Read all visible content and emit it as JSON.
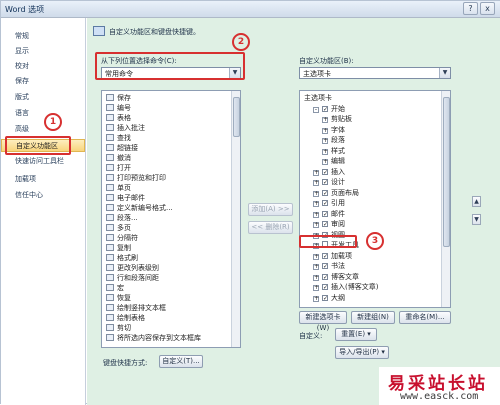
{
  "window": {
    "title": "Word 选项",
    "help_button": "?",
    "close_button": "x"
  },
  "sidebar": {
    "items": [
      {
        "label": "常规"
      },
      {
        "label": "显示"
      },
      {
        "label": "校对"
      },
      {
        "label": "保存"
      },
      {
        "label": "版式"
      },
      {
        "label": "语言"
      },
      {
        "label": "高级"
      },
      {
        "label": "自定义功能区"
      },
      {
        "label": "快速访问工具栏"
      },
      {
        "label": "加载项"
      },
      {
        "label": "信任中心"
      }
    ]
  },
  "header": {
    "description": "自定义功能区和键盘快捷键。"
  },
  "left_panel": {
    "label": "从下列位置选择命令(C):",
    "combo_value": "常用命令",
    "commands": [
      "保存",
      "编号",
      "表格",
      "插入批注",
      "查找",
      "超链接",
      "撤消",
      "打开",
      "打印预览和打印",
      "单页",
      "电子邮件",
      "定义新编号格式...",
      "段落...",
      "多页",
      "分隔符",
      "复制",
      "格式刷",
      "更改列表级别",
      "行和段落间距",
      "宏",
      "恢复",
      "绘制竖排文本框",
      "绘制表格",
      "剪切",
      "将所选内容保存到文本框库"
    ]
  },
  "right_panel": {
    "label": "自定义功能区(B):",
    "combo_value": "主选项卡",
    "tree": [
      {
        "text": "主选项卡",
        "level": 0,
        "exp": "",
        "chk": ""
      },
      {
        "text": "开始",
        "level": 1,
        "exp": "-",
        "chk": "✓"
      },
      {
        "text": "剪贴板",
        "level": 2,
        "exp": "+",
        "chk": ""
      },
      {
        "text": "字体",
        "level": 2,
        "exp": "+",
        "chk": ""
      },
      {
        "text": "段落",
        "level": 2,
        "exp": "+",
        "chk": ""
      },
      {
        "text": "样式",
        "level": 2,
        "exp": "+",
        "chk": ""
      },
      {
        "text": "编辑",
        "level": 2,
        "exp": "+",
        "chk": ""
      },
      {
        "text": "插入",
        "level": 1,
        "exp": "+",
        "chk": "✓"
      },
      {
        "text": "设计",
        "level": 1,
        "exp": "+",
        "chk": "✓"
      },
      {
        "text": "页面布局",
        "level": 1,
        "exp": "+",
        "chk": "✓"
      },
      {
        "text": "引用",
        "level": 1,
        "exp": "+",
        "chk": "✓"
      },
      {
        "text": "邮件",
        "level": 1,
        "exp": "+",
        "chk": "✓"
      },
      {
        "text": "审阅",
        "level": 1,
        "exp": "+",
        "chk": "✓"
      },
      {
        "text": "视图",
        "level": 1,
        "exp": "+",
        "chk": "✓"
      },
      {
        "text": "开发工具",
        "level": 1,
        "exp": "+",
        "chk": ""
      },
      {
        "text": "加载项",
        "level": 1,
        "exp": "+",
        "chk": "✓"
      },
      {
        "text": "书法",
        "level": 1,
        "exp": "+",
        "chk": "✓"
      },
      {
        "text": "博客文章",
        "level": 1,
        "exp": "+",
        "chk": "✓"
      },
      {
        "text": "插入(博客文章)",
        "level": 1,
        "exp": "+",
        "chk": "✓"
      },
      {
        "text": "大纲",
        "level": 1,
        "exp": "+",
        "chk": "✓"
      }
    ]
  },
  "middle_buttons": {
    "add": "添加(A) >>",
    "remove": "<< 删除(R)"
  },
  "bottom": {
    "keyboard_label": "键盘快捷方式:",
    "customize_button": "自定义(T)...",
    "new_tab": "新建选项卡(W)",
    "new_group": "新建组(N)",
    "rename": "重命名(M)...",
    "customization_label": "自定义:",
    "reset": "重置(E) ▾",
    "import_export": "导入/导出(P) ▾"
  },
  "annotations": {
    "one": "1",
    "two": "2",
    "three": "3"
  },
  "watermark": {
    "site_cn": "易采站长站",
    "url": "www.easck.com"
  }
}
